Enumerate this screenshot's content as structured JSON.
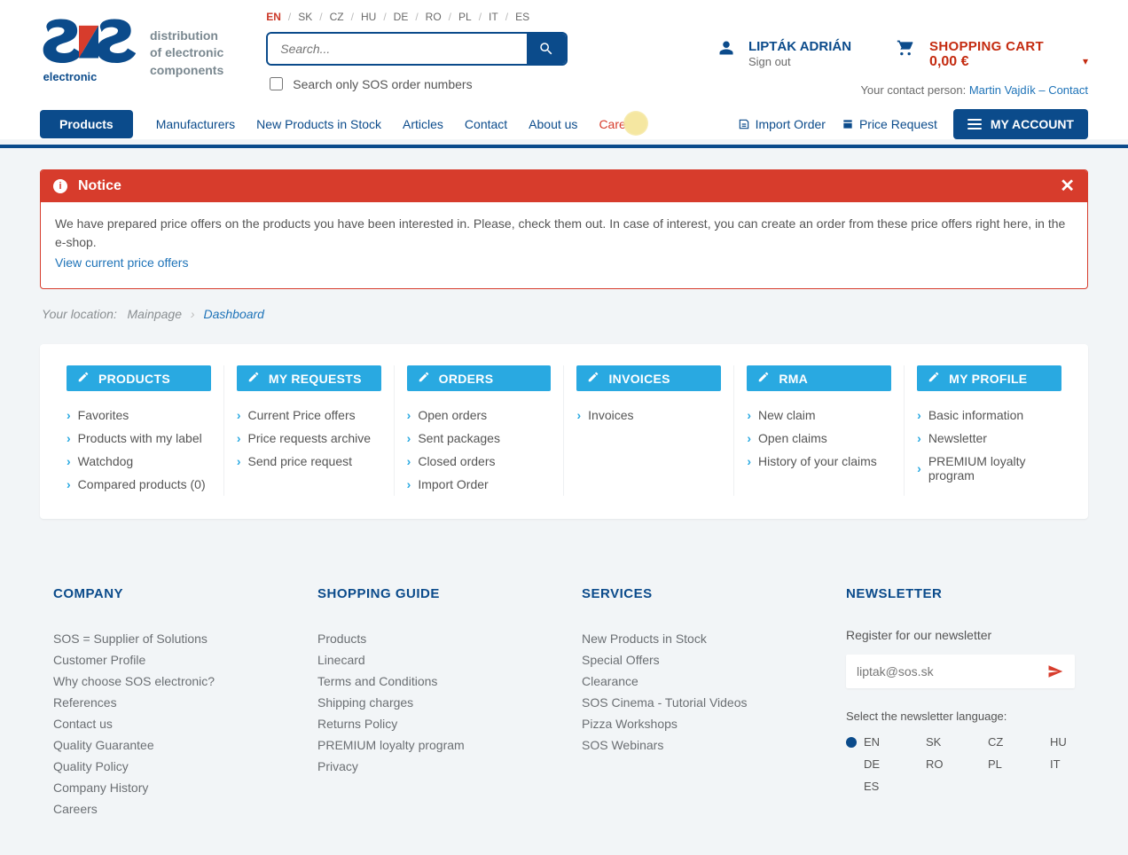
{
  "header": {
    "tagline_l1": "distribution",
    "tagline_l2": "of electronic",
    "tagline_l3": "components",
    "languages": [
      "EN",
      "SK",
      "CZ",
      "HU",
      "DE",
      "RO",
      "PL",
      "IT",
      "ES"
    ],
    "active_lang": "EN",
    "search_placeholder": "Search...",
    "search_only_label": "Search only SOS order numbers",
    "user_name": "LIPTÁK ADRIÁN",
    "sign_out": "Sign out",
    "contact_prefix": "Your contact person: ",
    "contact_link": "Martin Vajdík – Contact",
    "cart_title": "SHOPPING CART",
    "cart_amount": "0,00  €"
  },
  "nav": {
    "products_btn": "Products",
    "links": [
      "Manufacturers",
      "New Products in Stock",
      "Articles",
      "Contact",
      "About us",
      "Career"
    ],
    "import_order": "Import Order",
    "price_request": "Price Request",
    "my_account": "MY ACCOUNT"
  },
  "notice": {
    "title": "Notice",
    "body": "We have prepared price offers on the products you have been interested in. Please, check them out. In case of interest, you can create an order from these price offers right here, in the e-shop.",
    "link": "View current price offers"
  },
  "breadcrumb": {
    "label": "Your location:",
    "main": "Mainpage",
    "current": "Dashboard"
  },
  "dashboard": {
    "cols": [
      {
        "title": "PRODUCTS",
        "items": [
          "Favorites",
          "Products with my label",
          "Watchdog",
          "Compared products (0)"
        ]
      },
      {
        "title": "MY REQUESTS",
        "items": [
          "Current Price offers",
          "Price requests archive",
          "Send price request"
        ]
      },
      {
        "title": "ORDERS",
        "items": [
          "Open orders",
          "Sent packages",
          "Closed orders",
          "Import Order"
        ]
      },
      {
        "title": "INVOICES",
        "items": [
          "Invoices"
        ]
      },
      {
        "title": "RMA",
        "items": [
          "New claim",
          "Open claims",
          "History of your claims"
        ]
      },
      {
        "title": "MY PROFILE",
        "items": [
          "Basic information",
          "Newsletter",
          "PREMIUM loyalty program"
        ]
      }
    ]
  },
  "footer": {
    "cols": [
      {
        "title": "COMPANY",
        "items": [
          "SOS = Supplier of Solutions",
          "Customer Profile",
          "Why choose SOS electronic?",
          "References",
          "Contact us",
          "Quality Guarantee",
          "Quality Policy",
          "Company History",
          "Careers"
        ]
      },
      {
        "title": "SHOPPING GUIDE",
        "items": [
          "Products",
          "Linecard",
          "Terms and Conditions",
          "Shipping charges",
          "Returns Policy",
          "PREMIUM loyalty program",
          "Privacy"
        ]
      },
      {
        "title": "SERVICES",
        "items": [
          "New Products in Stock",
          "Special Offers",
          "Clearance",
          "SOS Cinema - Tutorial Videos",
          "Pizza Workshops",
          "SOS Webinars"
        ]
      }
    ],
    "newsletter": {
      "title": "NEWSLETTER",
      "prompt": "Register for our newsletter",
      "email": "liptak@sos.sk",
      "lang_label": "Select the newsletter language:",
      "langs": [
        "EN",
        "SK",
        "CZ",
        "HU",
        "DE",
        "RO",
        "PL",
        "IT",
        "ES"
      ],
      "active_lang": "EN"
    }
  }
}
